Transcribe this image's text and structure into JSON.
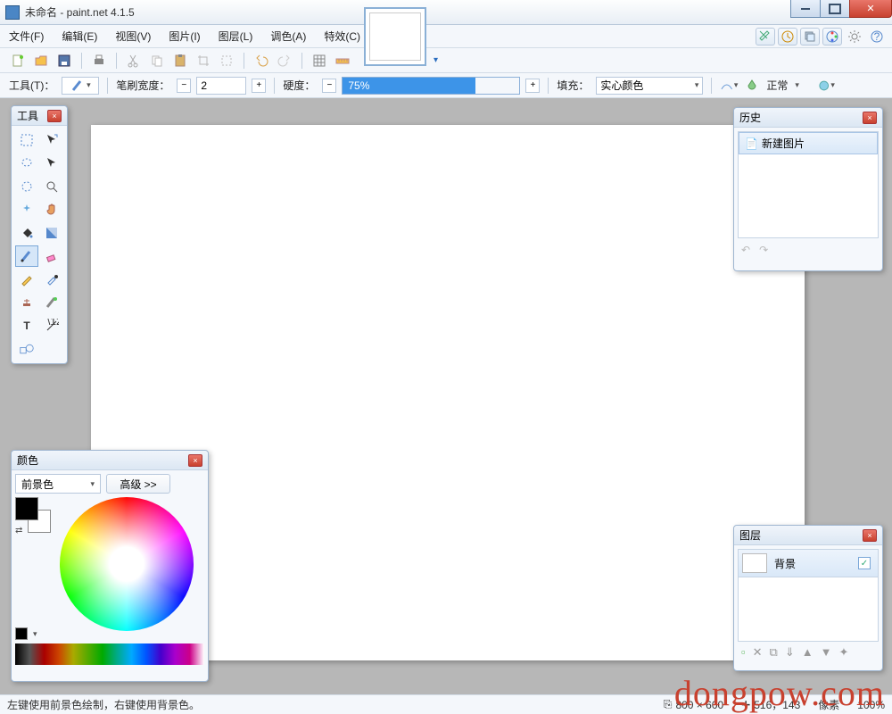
{
  "window": {
    "title": "未命名 - paint.net 4.1.5"
  },
  "menu": {
    "file": "文件(F)",
    "edit": "编辑(E)",
    "view": "视图(V)",
    "image": "图片(I)",
    "layers": "图层(L)",
    "adjust": "调色(A)",
    "effects": "特效(C)"
  },
  "toolbar2": {
    "tool_label": "工具(T)：",
    "brush_width_label": "笔刷宽度：",
    "brush_width_value": "2",
    "hardness_label": "硬度：",
    "hardness_value": "75%",
    "fill_label": "填充：",
    "fill_value": "实心颜色",
    "blend_label": "正常"
  },
  "panels": {
    "tools_title": "工具",
    "history_title": "历史",
    "history_item": "新建图片",
    "layers_title": "图层",
    "layer_bg": "背景",
    "colors_title": "颜色",
    "colors_mode": "前景色",
    "colors_advanced": "高级 >>"
  },
  "status": {
    "hint": "左键使用前景色绘制，右键使用背景色。",
    "dims": "800 × 600",
    "cursor": "516，143",
    "unit": "像素",
    "zoom": "100%"
  },
  "watermark": "dongpow.com"
}
